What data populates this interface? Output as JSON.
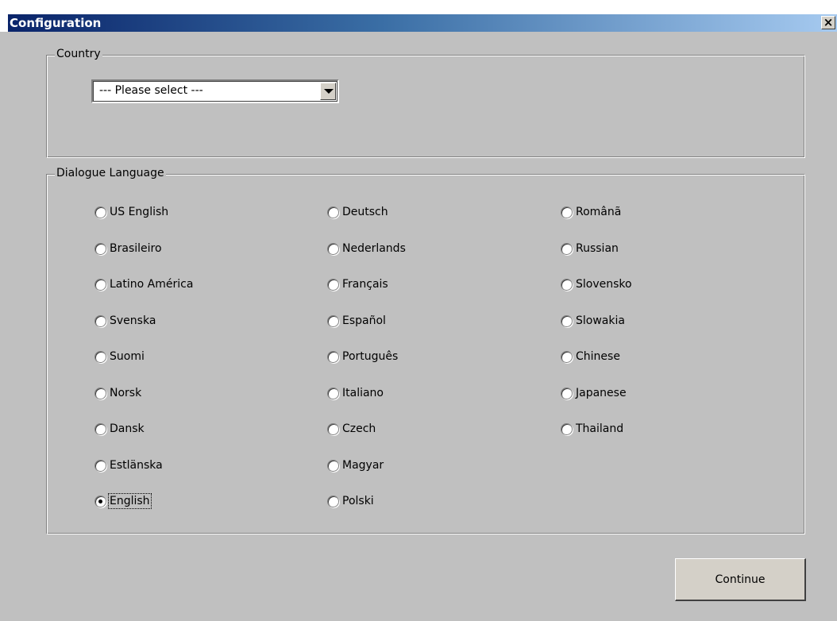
{
  "window": {
    "title": "Configuration",
    "close_label": "×"
  },
  "country": {
    "legend": "Country",
    "selected": "--- Please select ---"
  },
  "language": {
    "legend": "Dialogue Language",
    "selected": "English",
    "columns": [
      [
        "US English",
        "Brasileiro",
        "Latino América",
        "Svenska",
        "Suomi",
        "Norsk",
        "Dansk",
        "Estlänska",
        "English"
      ],
      [
        "Deutsch",
        "Nederlands",
        "Français",
        "Español",
        "Português",
        "Italiano",
        "Czech",
        "Magyar",
        "Polski"
      ],
      [
        "Românã",
        "Russian",
        "Slovensko",
        "Slowakia",
        "Chinese",
        "Japanese",
        "Thailand"
      ]
    ]
  },
  "actions": {
    "continue_label": "Continue"
  }
}
